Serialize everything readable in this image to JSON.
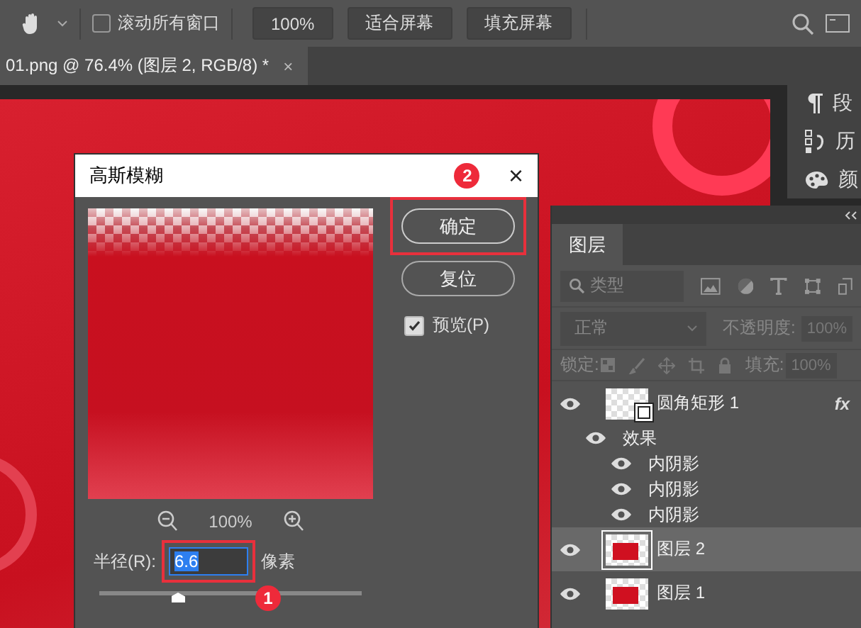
{
  "toolbar": {
    "scroll_all": {
      "label": "滚动所有窗口",
      "checked": false
    },
    "buttons": [
      "100%",
      "适合屏幕",
      "填充屏幕"
    ]
  },
  "document_tab": {
    "title": "01.png @ 76.4% (图层 2, RGB/8) *",
    "close": "×"
  },
  "side_panels": [
    {
      "kind": "paragraph",
      "label": "段"
    },
    {
      "kind": "history",
      "label": "历"
    },
    {
      "kind": "palette",
      "label": "颜"
    }
  ],
  "dialog": {
    "title": "高斯模糊",
    "close": "×",
    "title_badge": "2",
    "ok_button": {
      "label": "确定",
      "highlighted": true
    },
    "reset_button": "复位",
    "preview": {
      "label": "预览(P)",
      "checked": true
    },
    "zoom": "100%",
    "radius": {
      "label": "半径(R):",
      "value": "6.6",
      "unit": "像素",
      "highlighted": true,
      "badge": "1",
      "level": 0.3
    }
  },
  "layers_panel": {
    "title": "图层",
    "filter": {
      "placeholder": "类型"
    },
    "blend_mode": "正常",
    "opacity": {
      "label": "不透明度:",
      "value": "100%"
    },
    "lock_label": "锁定:",
    "fill": {
      "label": "填充:",
      "value": "100%"
    },
    "layers": [
      {
        "name": "圆角矩形 1",
        "kind": "shape",
        "visible": true,
        "selected": false,
        "fx": "fx",
        "children": [
          {
            "name": "效果",
            "visible": true,
            "children": [
              {
                "name": "内阴影",
                "visible": true
              },
              {
                "name": "内阴影",
                "visible": true
              },
              {
                "name": "内阴影",
                "visible": true
              }
            ]
          }
        ]
      },
      {
        "name": "图层 2",
        "kind": "pixel",
        "visible": true,
        "selected": true
      },
      {
        "name": "图层 1",
        "kind": "pixel",
        "visible": true,
        "selected": false
      }
    ]
  }
}
